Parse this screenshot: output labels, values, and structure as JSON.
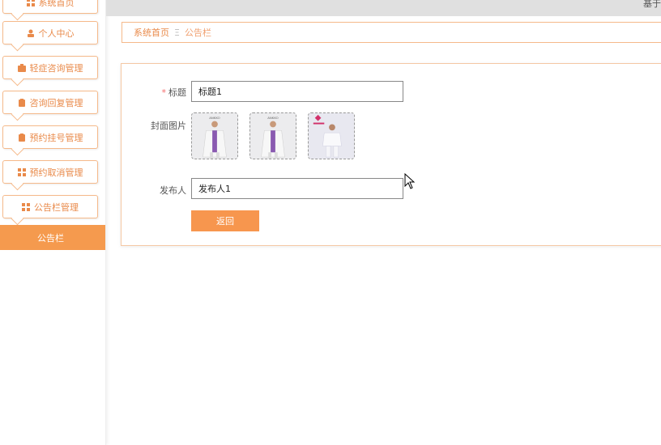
{
  "topbar": {
    "user_text": "基于"
  },
  "sidebar": {
    "items": [
      {
        "label": "系统首页",
        "icon": "grid-icon"
      },
      {
        "label": "个人中心",
        "icon": "user-icon"
      },
      {
        "label": "轻症咨询管理",
        "icon": "briefcase-icon"
      },
      {
        "label": "咨询回复管理",
        "icon": "clipboard-icon"
      },
      {
        "label": "预约挂号管理",
        "icon": "clipboard-icon"
      },
      {
        "label": "预约取消管理",
        "icon": "grid-icon"
      },
      {
        "label": "公告栏管理",
        "icon": "grid-icon"
      }
    ],
    "active_sub": "公告栏"
  },
  "breadcrumb": {
    "home": "系统首页",
    "separator": "Ξ",
    "current": "公告栏"
  },
  "form": {
    "title_label": "标题",
    "title_required": "*",
    "title_value": "标题1",
    "cover_label": "封面图片",
    "publisher_label": "发布人",
    "publisher_value": "发布人1",
    "back_button": "返回"
  },
  "colors": {
    "accent": "#f7964e",
    "border": "#f5b98a",
    "text_accent": "#e98a4a"
  }
}
